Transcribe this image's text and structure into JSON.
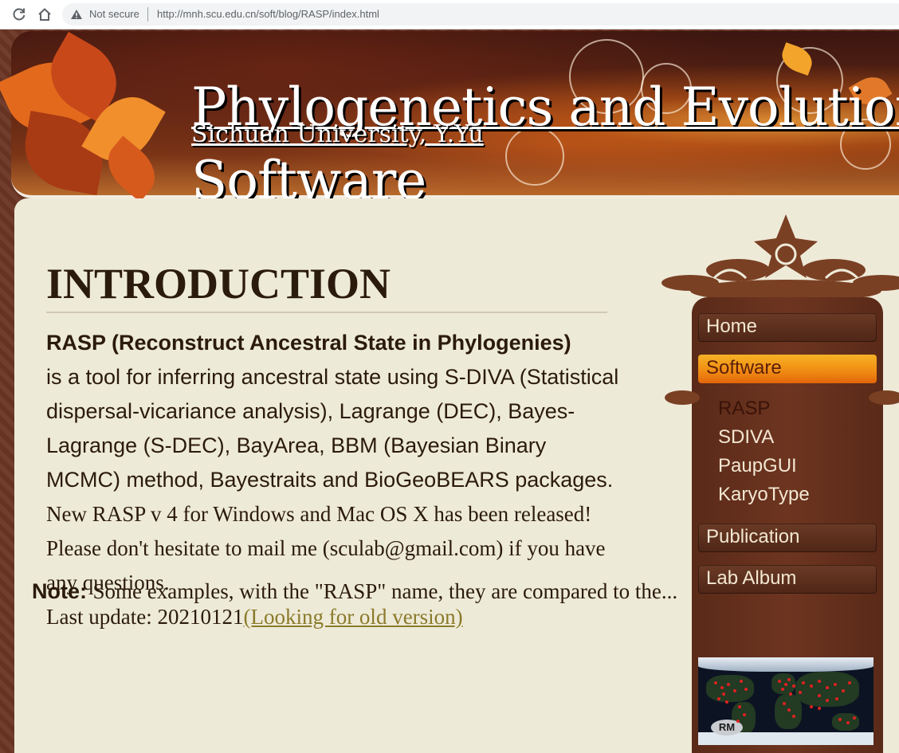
{
  "browser": {
    "security_label": "Not secure",
    "url": "http://mnh.scu.edu.cn/soft/blog/RASP/index.html"
  },
  "header": {
    "title_line1": "Phylogenetics and Evolution",
    "title_line2": "Software",
    "subtitle": "Sichuan University, Y.Yu"
  },
  "main": {
    "heading": "INTRODUCTION",
    "lead_bold": "RASP (Reconstruct Ancestral State in Phylogenies)",
    "lead_rest": "is a tool for inferring ancestral state using S-DIVA (Statistical dispersal-vicariance analysis), Lagrange (DEC), Bayes-Lagrange (S-DEC), BayArea, BBM (Bayesian Binary MCMC) method, Bayestraits and BioGeoBEARS packages.",
    "release_note": "New RASP v 4 for Windows and Mac OS X has been released!",
    "contact_note": "Please don't hesitate to mail me (sculab@gmail.com) if you have any questions.",
    "last_update": "Last update: 20210121",
    "old_version_link": "(Looking for old version)",
    "note_label": "Note:",
    "note_text": "Some examples, with the \"RASP\" name, they are compared to the..."
  },
  "sidebar": {
    "menu": [
      {
        "label": "Home"
      },
      {
        "label": "Software"
      },
      {
        "label": "Publication"
      },
      {
        "label": "Lab Album"
      }
    ],
    "submenu": [
      {
        "label": "RASP"
      },
      {
        "label": "SDIVA"
      },
      {
        "label": "PaupGUI"
      },
      {
        "label": "KaryoType"
      }
    ],
    "map_badge": "RM"
  },
  "colors": {
    "content_bg": "#eeead8",
    "active_menu": "#f08a12",
    "link": "#8a7a2a"
  }
}
